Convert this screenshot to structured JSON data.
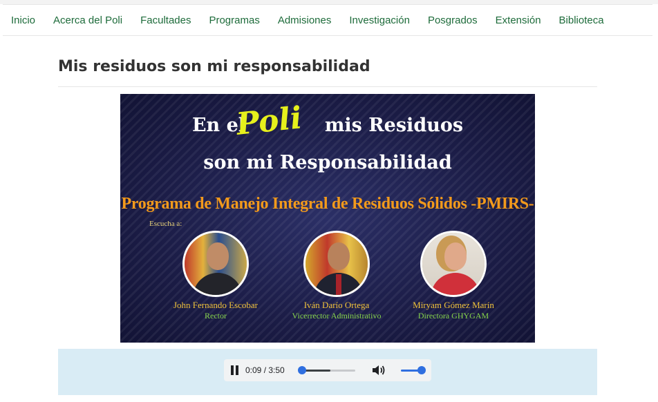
{
  "nav": {
    "items": [
      "Inicio",
      "Acerca del Poli",
      "Facultades",
      "Programas",
      "Admisiones",
      "Investigación",
      "Posgrados",
      "Extensión",
      "Biblioteca"
    ]
  },
  "page": {
    "title": "Mis residuos son mi responsabilidad"
  },
  "banner": {
    "line1_left": "En el",
    "poli": "Poli",
    "line1_right": "mis Residuos",
    "line2": "son mi  Responsabilidad",
    "program": "Programa de Manejo Integral de Residuos Sólidos -PMIRS-",
    "escucha": "Escucha a:",
    "people": [
      {
        "name": "John Fernando Escobar",
        "role": "Rector"
      },
      {
        "name": "Iván Darío Ortega",
        "role": "Vicerrector Administrativo"
      },
      {
        "name": "Miryam Gómez Marín",
        "role": "Directora GHYGAM"
      }
    ]
  },
  "audio": {
    "time": "0:09 / 3:50",
    "progress_fraction": 0.04,
    "buffered_fraction": 0.55,
    "volume_fraction": 1.0,
    "accent": "#2f6fe0"
  },
  "colors": {
    "nav_link": "#1d6b3a",
    "audio_bg": "#d9ecf5",
    "banner_yellow": "#e6f01c",
    "banner_orange": "#f39a1b"
  }
}
